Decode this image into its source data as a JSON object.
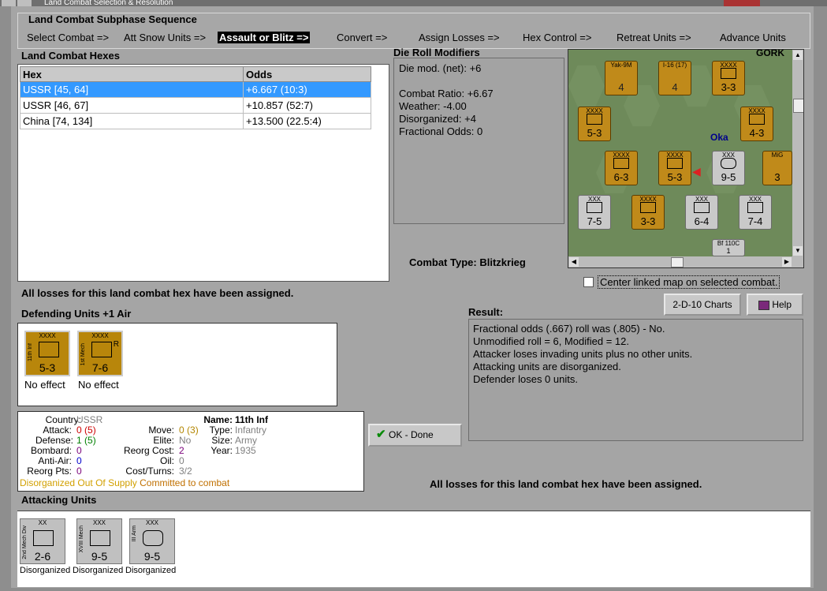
{
  "window": {
    "title": "Land Combat Selection & Resolution"
  },
  "sequence": {
    "title": "Land Combat Subphase Sequence",
    "steps": [
      "Select Combat =>",
      "Att Snow Units =>",
      "Assault or Blitz =>",
      "Convert =>",
      "Assign Losses =>",
      "Hex Control =>",
      "Retreat Units =>",
      "Advance Units"
    ],
    "active_index": 2
  },
  "hexes": {
    "title": "Land Combat Hexes",
    "columns": [
      "Hex",
      "Odds"
    ],
    "rows": [
      {
        "hex": "USSR [45, 64]",
        "odds": "+6.667 (10:3)"
      },
      {
        "hex": "USSR [46, 67]",
        "odds": "+10.857 (52:7)"
      },
      {
        "hex": "China [74, 134]",
        "odds": "+13.500 (22.5:4)"
      }
    ],
    "selected_index": 0
  },
  "die_roll": {
    "title": "Die Roll Modifiers",
    "lines": [
      "Die mod. (net): +6",
      "",
      "Combat Ratio: +6.67",
      "Weather: -4.00",
      "Disorganized: +4",
      "Fractional Odds: 0"
    ]
  },
  "map": {
    "labels": [
      "GORK",
      "Oka"
    ],
    "counters": [
      {
        "top": "Yak-9M",
        "val": "4",
        "color": "orange"
      },
      {
        "top": "I-16 (17)",
        "val": "4",
        "color": "orange"
      },
      {
        "top": "XXXX",
        "val": "3-3",
        "color": "orange"
      },
      {
        "top": "XXXX",
        "val": "5-3",
        "color": "orange"
      },
      {
        "top": "XXXX",
        "val": "4-3",
        "color": "orange"
      },
      {
        "top": "XXXX",
        "val": "6-3",
        "color": "orange"
      },
      {
        "top": "XXXX",
        "val": "5-3",
        "color": "orange"
      },
      {
        "top": "XXX",
        "val": "9-5",
        "color": "gray"
      },
      {
        "top": "MiG",
        "val": "3",
        "color": "orange"
      },
      {
        "top": "XXX",
        "val": "7-5",
        "color": "gray"
      },
      {
        "top": "XXXX",
        "val": "3-3",
        "color": "orange"
      },
      {
        "top": "XXX",
        "val": "6-4",
        "color": "gray"
      },
      {
        "top": "XXX",
        "val": "7-4",
        "color": "gray"
      },
      {
        "top": "Bf 110C",
        "val": "1",
        "color": "gray"
      }
    ]
  },
  "combat_type": {
    "label": "Combat Type:",
    "value": "Blitzkrieg"
  },
  "center_checkbox": {
    "label": "Center linked map on selected combat.",
    "checked": false
  },
  "losses_message": "All losses for this land combat hex have been assigned.",
  "buttons": {
    "charts": "2-D-10 Charts",
    "help": "Help",
    "ok": "OK - Done"
  },
  "defending": {
    "title": "Defending Units +1 Air",
    "units": [
      {
        "name": "11th Inf",
        "size": "XXXX",
        "val": "5-3",
        "effect": "No effect"
      },
      {
        "name": "1st Mech",
        "size": "XXXX",
        "val": "7-6",
        "effect": "No effect",
        "flag": "R"
      }
    ]
  },
  "unit_info": {
    "country_label": "Country:",
    "country": "USSR",
    "attack_label": "Attack:",
    "attack": "0",
    "attack_base": "(5)",
    "defense_label": "Defense:",
    "defense": "1",
    "defense_base": "(5)",
    "bombard_label": "Bombard:",
    "bombard": "0",
    "antiair_label": "Anti-Air:",
    "antiair": "0",
    "reorg_label": "Reorg Pts:",
    "reorg": "0",
    "move_label": "Move:",
    "move": "0",
    "move_base": "(3)",
    "elite_label": "Elite:",
    "elite": "No",
    "reorg_cost_label": "Reorg Cost:",
    "reorg_cost": "2",
    "oil_label": "Oil:",
    "oil": "0",
    "cost_label": "Cost/Turns:",
    "cost": "3/2",
    "name_label": "Name:",
    "name": "11th Inf",
    "type_label": "Type:",
    "type": "Infantry",
    "size_label": "Size:",
    "size": "Army",
    "year_label": "Year:",
    "year": "1935",
    "status_disorg": "Disorganized",
    "status_supply": "Out Of Supply",
    "status_committed": "Committed to combat"
  },
  "result": {
    "title": "Result:",
    "lines": [
      "Fractional odds (.667) roll was (.805)  - No.",
      "Unmodified roll = 6, Modified = 12.",
      "Attacker loses invading units plus no other units.",
      "Attacking units are disorganized.",
      "Defender loses 0 units."
    ]
  },
  "losses_message_2": "All losses for this land combat hex have been assigned.",
  "attacking": {
    "title": "Attacking Units",
    "units": [
      {
        "name": "2nd Mech Div",
        "size": "XX",
        "val": "2-6",
        "effect": "Disorganized"
      },
      {
        "name": "XVIII Mech",
        "size": "XXX",
        "val": "9-5",
        "effect": "Disorganized"
      },
      {
        "name": "III Arm",
        "size": "XXX",
        "val": "9-5",
        "effect": "Disorganized"
      }
    ]
  },
  "colors": {
    "selected_row": "#3399ff",
    "attack_red": "#cc0000",
    "defense_green": "#008000",
    "purple": "#7a007a",
    "blue": "#0000cc",
    "gray_value": "#808080",
    "status_orange": "#d2a000"
  }
}
